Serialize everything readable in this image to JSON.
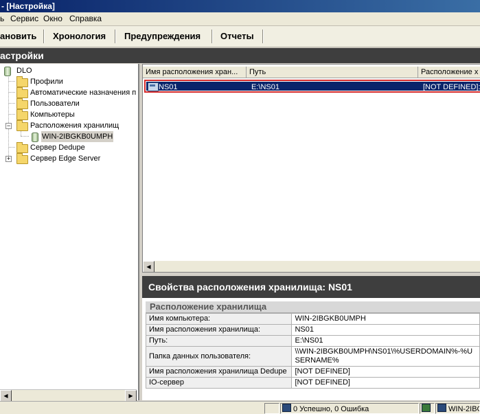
{
  "window": {
    "title": "- [Настройка]"
  },
  "menu": {
    "items": [
      "Сервис",
      "Окно",
      "Справка"
    ]
  },
  "toolbar": {
    "buttons": [
      "ановить",
      "Хронология",
      "Предупреждения",
      "Отчеты"
    ]
  },
  "section_header": "астройки",
  "tree": {
    "root": "DLO",
    "items": [
      "Профили",
      "Автоматические назначения п",
      "Пользователи",
      "Компьютеры",
      "Расположения хранилищ",
      "WIN-2IBGKB0UMPH",
      "Сервер Dedupe",
      "Сервер Edge Server"
    ],
    "selected": "WIN-2IBGKB0UMPH"
  },
  "list": {
    "columns": [
      "Имя расположения хран...",
      "Путь",
      "Расположение х"
    ],
    "rows": [
      {
        "name": "NS01",
        "path": "E:\\NS01",
        "location": "[NOT DEFINED]:["
      }
    ]
  },
  "properties": {
    "title": "Свойства расположения хранилища: NS01",
    "group_title": "Расположение хранилища",
    "rows": [
      {
        "key": "Имя компьютера:",
        "value": "WIN-2IBGKB0UMPH"
      },
      {
        "key": "Имя расположения хранилища:",
        "value": "NS01"
      },
      {
        "key": "Путь:",
        "value": "E:\\NS01"
      },
      {
        "key": "Папка данных пользователя:",
        "value": "\\\\WIN-2IBGKB0UMPH\\NS01\\%USERDOMAIN%-%USERNAME%"
      },
      {
        "key": "Имя расположения хранилища Dedupe",
        "value": "[NOT DEFINED]"
      },
      {
        "key": "IO-сервер",
        "value": "[NOT DEFINED]"
      }
    ]
  },
  "statusbar": {
    "result": "0 Успешно, 0 Ошибка",
    "server": "WIN-2IBG"
  }
}
